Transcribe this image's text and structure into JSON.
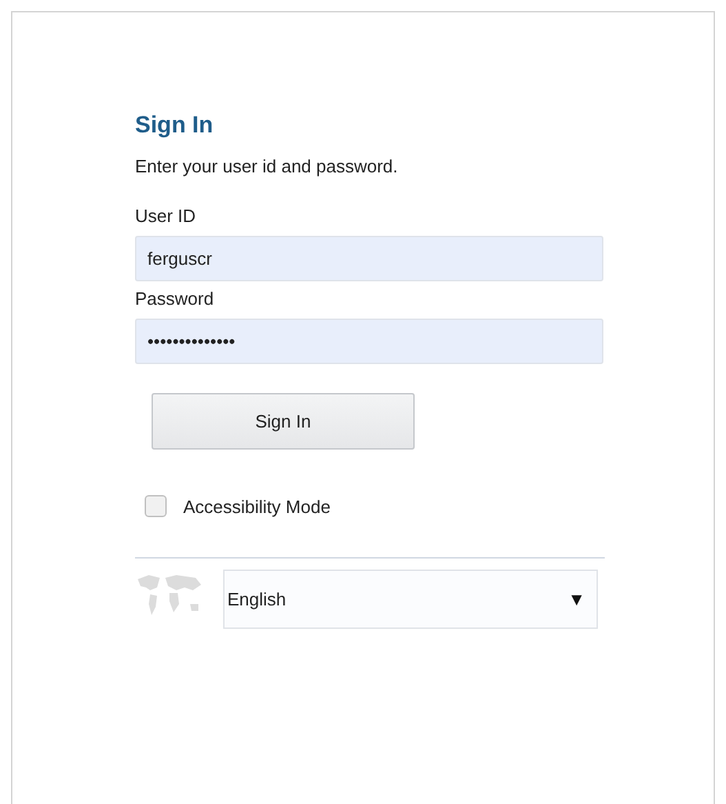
{
  "title": "Sign In",
  "instructions": "Enter your user id and password.",
  "fields": [
    {
      "label": "User ID",
      "value": "ferguscr"
    },
    {
      "label": "Password",
      "value": "••••••••••••••"
    }
  ],
  "submit": "Sign In",
  "accessibility": {
    "label": "Accessibility Mode",
    "checked": false
  },
  "language": {
    "value": "English",
    "arrow": "▼"
  }
}
